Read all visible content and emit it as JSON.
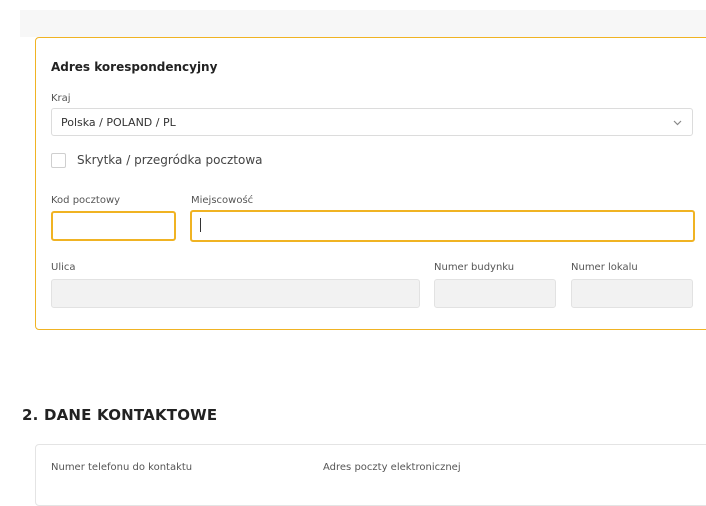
{
  "address_card": {
    "title": "Adres korespondencyjny",
    "country": {
      "label": "Kraj",
      "selected": "Polska / POLAND / PL"
    },
    "po_box_checkbox": {
      "label": "Skrytka / przegródka pocztowa",
      "checked": false
    },
    "postal_code": {
      "label": "Kod pocztowy",
      "value": ""
    },
    "city": {
      "label": "Miejscowość",
      "value": ""
    },
    "street": {
      "label": "Ulica",
      "value": ""
    },
    "building_number": {
      "label": "Numer budynku",
      "value": ""
    },
    "apartment_number": {
      "label": "Numer lokalu",
      "value": ""
    }
  },
  "contact_section": {
    "title": "2. DANE KONTAKTOWE",
    "phone_label": "Numer telefonu do kontaktu",
    "email_label": "Adres poczty elektronicznej"
  },
  "colors": {
    "accent": "#f0b323",
    "disabled_field": "#f2f2f2"
  },
  "icons": {
    "select_chevron": "chevron-down-icon"
  }
}
